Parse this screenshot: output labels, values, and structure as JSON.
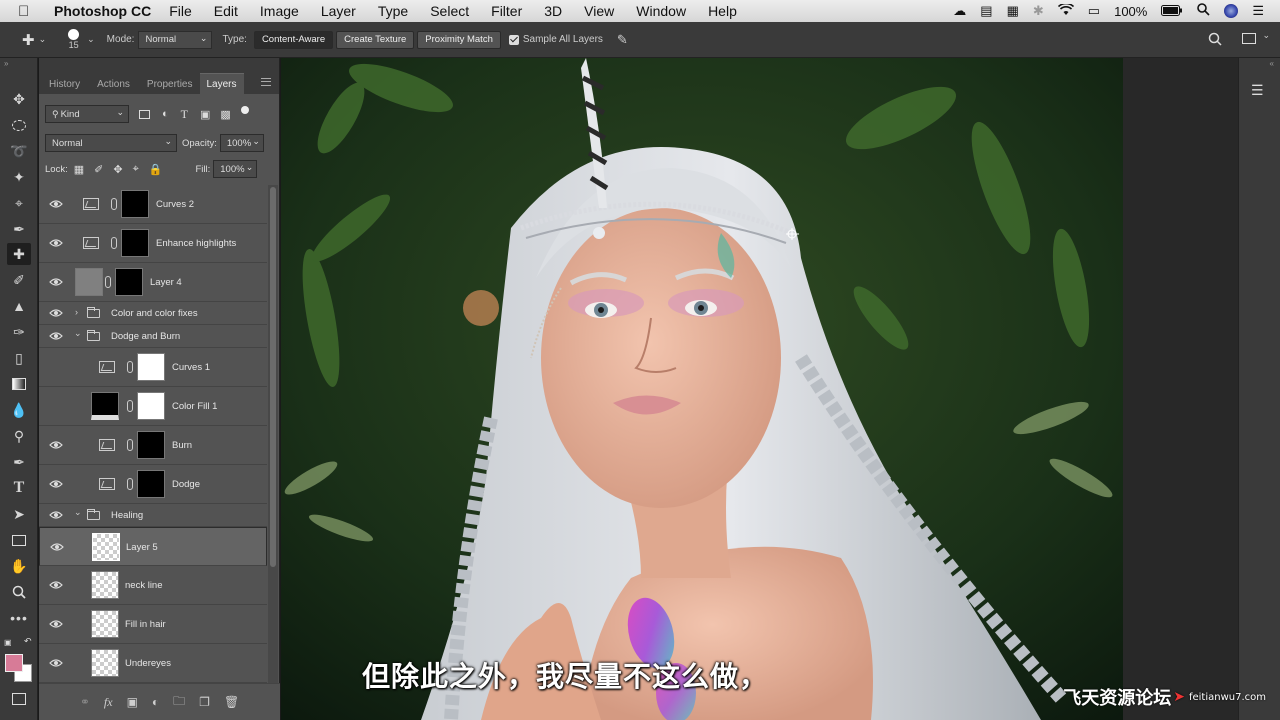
{
  "menubar": {
    "app_name": "Photoshop CC",
    "items": [
      "File",
      "Edit",
      "Image",
      "Layer",
      "Type",
      "Select",
      "Filter",
      "3D",
      "View",
      "Window",
      "Help"
    ],
    "battery": "100%"
  },
  "options": {
    "brush_size": "15",
    "mode_label": "Mode:",
    "mode_value": "Normal",
    "type_label": "Type:",
    "type_buttons": [
      "Content-Aware",
      "Create Texture",
      "Proximity Match"
    ],
    "sample_all_label": "Sample All Layers"
  },
  "panel": {
    "tabs": [
      "History",
      "Actions",
      "Properties",
      "Layers"
    ],
    "filter_kind": "Kind",
    "blend_mode": "Normal",
    "opacity_label": "Opacity:",
    "opacity_value": "100%",
    "lock_label": "Lock:",
    "fill_label": "Fill:",
    "fill_value": "100%"
  },
  "layers": [
    {
      "name": "Curves 2"
    },
    {
      "name": "Enhance highlights"
    },
    {
      "name": "Layer 4"
    },
    {
      "name": "Color and color fixes"
    },
    {
      "name": "Dodge and Burn"
    },
    {
      "name": "Curves 1"
    },
    {
      "name": "Color Fill 1"
    },
    {
      "name": "Burn"
    },
    {
      "name": "Dodge"
    },
    {
      "name": "Healing"
    },
    {
      "name": "Layer 5"
    },
    {
      "name": "neck line"
    },
    {
      "name": "Fill in hair"
    },
    {
      "name": "Undereyes"
    }
  ],
  "colors": {
    "foreground": "#d77b97",
    "background": "#ffffff"
  },
  "subtitle": "但除此之外，我尽量不这么做，",
  "watermark": {
    "text": "飞天资源论坛",
    "url": "feitianwu7.com"
  }
}
